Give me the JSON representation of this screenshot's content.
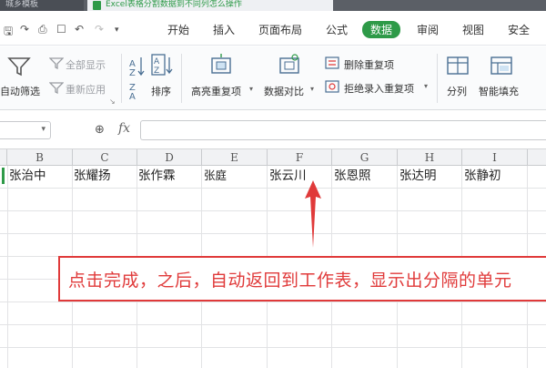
{
  "titlebar": {
    "tab_left": "城乡模板",
    "tab_doc": "Excel表格分割数据到不同列怎么操作"
  },
  "menubar": {
    "items": [
      "开始",
      "插入",
      "页面布局",
      "公式",
      "数据",
      "审阅",
      "视图",
      "安全"
    ],
    "active": "数据",
    "quick_access": [
      "save-icon",
      "redo-icon",
      "print-icon",
      "preview-icon",
      "undo-icon",
      "redo-icon",
      "more-icon"
    ]
  },
  "ribbon": {
    "autofilter": "自动筛选",
    "show_all": "全部显示",
    "reapply": "重新应用",
    "sort": "排序",
    "highlight_dup": "高亮重复项",
    "compare": "数据对比",
    "delete_dup": "删除重复项",
    "reject_dup": "拒绝录入重复项",
    "split": "分列",
    "smart_fill": "智能填充"
  },
  "formula_bar": {
    "fx": "fx",
    "value": ""
  },
  "columns": [
    "B",
    "C",
    "D",
    "E",
    "F",
    "G",
    "H",
    "I"
  ],
  "row1": [
    "张治中",
    "张耀扬",
    "张作霖",
    "张庭",
    "张云川",
    "张恩照",
    "张达明",
    "张静初"
  ],
  "annotation": {
    "text": "点击完成，之后，自动返回到工作表，显示出分隔的单元"
  },
  "colors": {
    "accent": "#2e9a48",
    "annotation": "#e03a3a"
  }
}
